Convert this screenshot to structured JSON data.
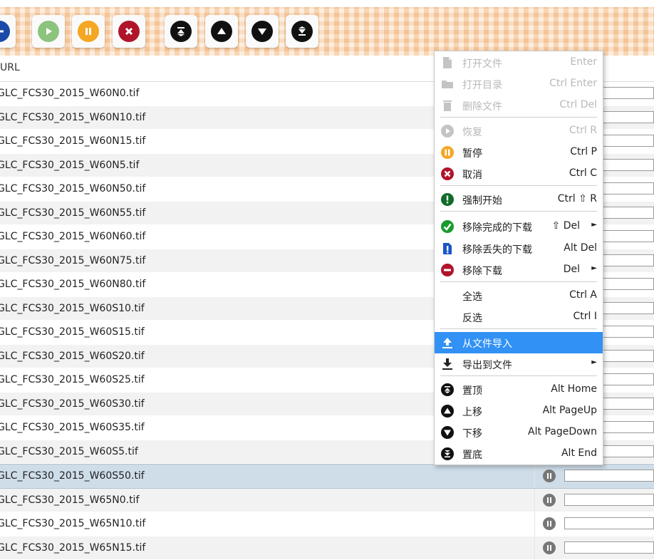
{
  "toolbar": {
    "buttons": [
      {
        "name": "add-icon",
        "color": "#1a4aa8"
      },
      {
        "name": "resume-icon",
        "color": "#7fbf6f"
      },
      {
        "name": "pause-icon",
        "color": "#f5a623"
      },
      {
        "name": "cancel-icon",
        "color": "#b0142b"
      },
      {
        "name": "move-top-icon",
        "color": "#111111"
      },
      {
        "name": "move-up-icon",
        "color": "#111111"
      },
      {
        "name": "move-down-icon",
        "color": "#111111"
      },
      {
        "name": "move-bottom-icon",
        "color": "#111111"
      }
    ]
  },
  "table": {
    "url_header": "URL",
    "rows": [
      "GLC_FCS30_2015_W60N0.tif",
      "GLC_FCS30_2015_W60N10.tif",
      "GLC_FCS30_2015_W60N15.tif",
      "GLC_FCS30_2015_W60N5.tif",
      "GLC_FCS30_2015_W60N50.tif",
      "GLC_FCS30_2015_W60N55.tif",
      "GLC_FCS30_2015_W60N60.tif",
      "GLC_FCS30_2015_W60N75.tif",
      "GLC_FCS30_2015_W60N80.tif",
      "GLC_FCS30_2015_W60S10.tif",
      "GLC_FCS30_2015_W60S15.tif",
      "GLC_FCS30_2015_W60S20.tif",
      "GLC_FCS30_2015_W60S25.tif",
      "GLC_FCS30_2015_W60S30.tif",
      "GLC_FCS30_2015_W60S35.tif",
      "GLC_FCS30_2015_W60S5.tif",
      "GLC_FCS30_2015_W60S50.tif",
      "GLC_FCS30_2015_W65N0.tif",
      "GLC_FCS30_2015_W65N10.tif",
      "GLC_FCS30_2015_W65N15.tif"
    ],
    "selected_row": "GLC_FCS30_2015_W60S50.tif"
  },
  "context_menu": {
    "items": [
      {
        "label": "打开文件",
        "shortcut": "Enter",
        "icon": "file-icon",
        "disabled": true
      },
      {
        "label": "打开目录",
        "shortcut": "Ctrl Enter",
        "icon": "folder-icon",
        "disabled": true
      },
      {
        "label": "删除文件",
        "shortcut": "Ctrl Del",
        "icon": "trash-icon",
        "disabled": true
      },
      {
        "label": "恢复",
        "shortcut": "Ctrl R",
        "icon": "resume-icon",
        "disabled": true
      },
      {
        "label": "暂停",
        "shortcut": "Ctrl P",
        "icon": "pause-icon"
      },
      {
        "label": "取消",
        "shortcut": "Ctrl C",
        "icon": "cancel-icon"
      },
      {
        "label": "强制开始",
        "shortcut": "Ctrl ⇧ R",
        "icon": "force-start-icon"
      },
      {
        "label": "移除完成的下载",
        "shortcut": "⇧ Del",
        "icon": "check-icon",
        "submenu": true
      },
      {
        "label": "移除丢失的下载",
        "shortcut": "Alt Del",
        "icon": "missing-file-icon"
      },
      {
        "label": "移除下载",
        "shortcut": "Del",
        "icon": "remove-icon",
        "submenu": true
      },
      {
        "label": "全选",
        "shortcut": "Ctrl A",
        "icon": ""
      },
      {
        "label": "反选",
        "shortcut": "Ctrl I",
        "icon": ""
      },
      {
        "label": "从文件导入",
        "shortcut": "",
        "icon": "upload-icon",
        "highlighted": true
      },
      {
        "label": "导出到文件",
        "shortcut": "",
        "icon": "download-icon",
        "submenu": true
      },
      {
        "label": "置顶",
        "shortcut": "Alt Home",
        "icon": "move-top-icon"
      },
      {
        "label": "上移",
        "shortcut": "Alt PageUp",
        "icon": "move-up-icon"
      },
      {
        "label": "下移",
        "shortcut": "Alt PageDown",
        "icon": "move-down-icon"
      },
      {
        "label": "置底",
        "shortcut": "Alt End",
        "icon": "move-bottom-icon"
      }
    ],
    "submenu_arrow": "►"
  },
  "colors": {
    "highlight": "#3191f5",
    "selected_row": "#cfdde9",
    "pause": "#f5a623",
    "cancel": "#b0142b",
    "force_start": "#116b2a",
    "check": "#1a9a2e",
    "missing": "#1a56c8",
    "remove": "#b0142b"
  }
}
